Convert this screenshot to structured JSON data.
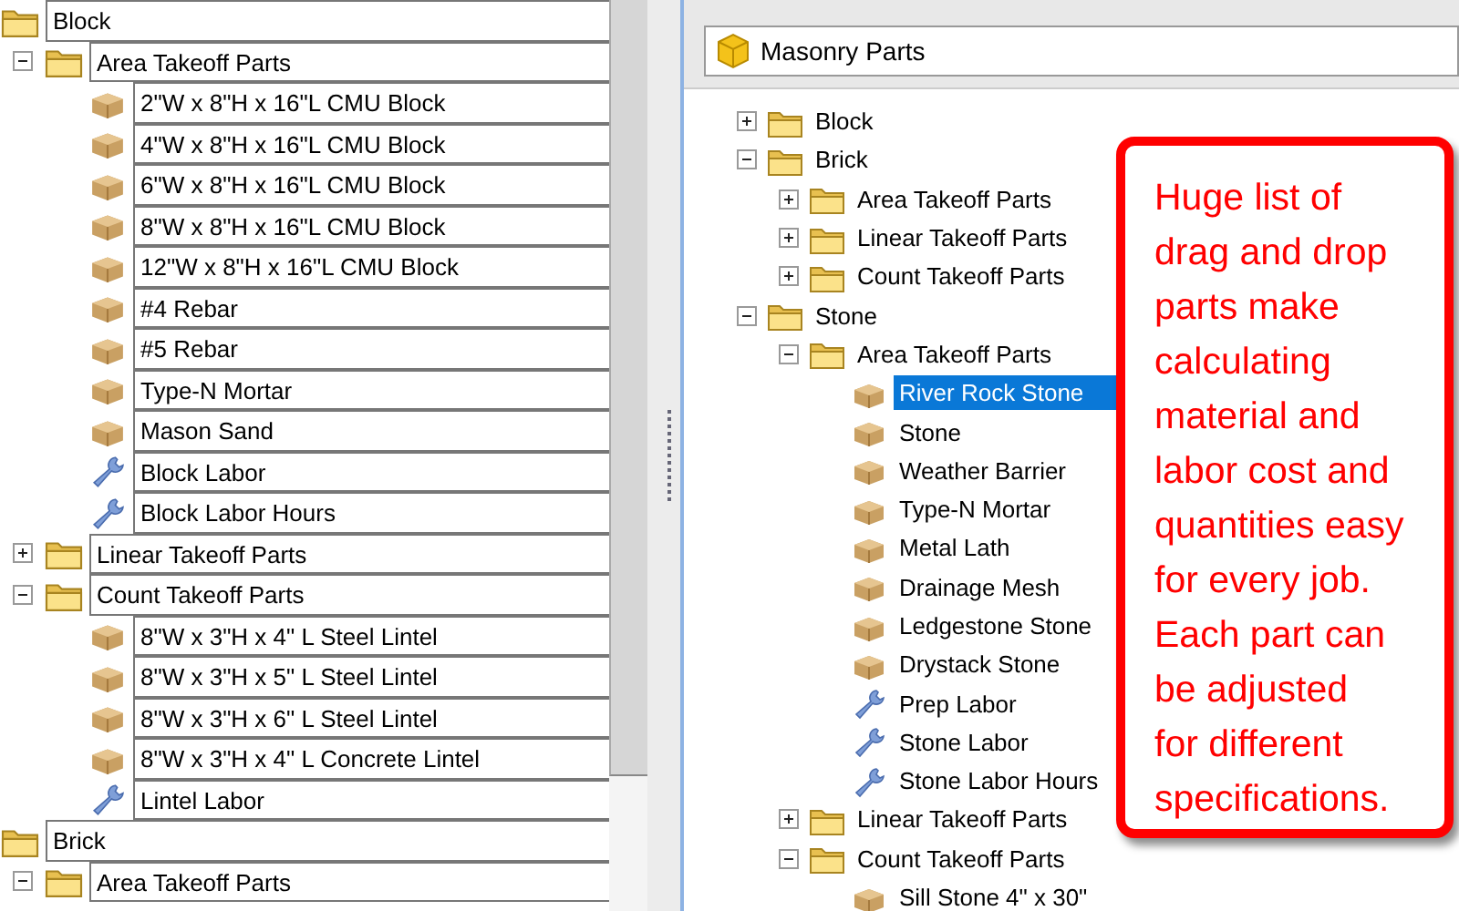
{
  "left_tree": {
    "items": [
      {
        "label": "Block",
        "kind": "folder",
        "children": [
          {
            "label": "Area Takeoff Parts",
            "kind": "folder",
            "expanded": true,
            "children": [
              {
                "label": "2\"W x 8\"H x 16\"L CMU Block",
                "kind": "part"
              },
              {
                "label": "4\"W x 8\"H x 16\"L CMU Block",
                "kind": "part"
              },
              {
                "label": "6\"W x 8\"H x 16\"L CMU Block",
                "kind": "part"
              },
              {
                "label": "8\"W x 8\"H x 16\"L CMU Block",
                "kind": "part"
              },
              {
                "label": "12\"W x 8\"H x 16\"L CMU Block",
                "kind": "part"
              },
              {
                "label": "#4 Rebar",
                "kind": "part"
              },
              {
                "label": "#5 Rebar",
                "kind": "part"
              },
              {
                "label": "Type-N Mortar",
                "kind": "part"
              },
              {
                "label": "Mason Sand",
                "kind": "part"
              },
              {
                "label": "Block Labor",
                "kind": "labor"
              },
              {
                "label": "Block Labor Hours",
                "kind": "labor"
              }
            ]
          },
          {
            "label": "Linear Takeoff Parts",
            "kind": "folder",
            "expanded": false
          },
          {
            "label": "Count Takeoff Parts",
            "kind": "folder",
            "expanded": true,
            "children": [
              {
                "label": "8\"W x 3\"H x 4\" L Steel Lintel",
                "kind": "part"
              },
              {
                "label": "8\"W x 3\"H x 5\" L Steel Lintel",
                "kind": "part"
              },
              {
                "label": "8\"W x 3\"H x 6\" L Steel Lintel",
                "kind": "part"
              },
              {
                "label": "8\"W x 3\"H x 4\" L Concrete Lintel",
                "kind": "part"
              },
              {
                "label": "Lintel Labor",
                "kind": "labor"
              }
            ]
          }
        ]
      },
      {
        "label": "Brick",
        "kind": "folder",
        "children": [
          {
            "label": "Area Takeoff Parts",
            "kind": "folder",
            "expanded": true
          }
        ]
      }
    ]
  },
  "right_panel": {
    "root": "Masonry Parts",
    "items": [
      {
        "label": "Block",
        "kind": "folder",
        "expanded": false,
        "selected": false
      },
      {
        "label": "Brick",
        "kind": "folder",
        "expanded": true,
        "selected": false,
        "children": [
          {
            "label": "Area Takeoff Parts",
            "kind": "folder",
            "expanded": false,
            "selected": false
          },
          {
            "label": "Linear Takeoff Parts",
            "kind": "folder",
            "expanded": false,
            "selected": false
          },
          {
            "label": "Count Takeoff Parts",
            "kind": "folder",
            "expanded": false,
            "selected": false
          }
        ]
      },
      {
        "label": "Stone",
        "kind": "folder",
        "expanded": true,
        "selected": false,
        "children": [
          {
            "label": "Area Takeoff Parts",
            "kind": "folder",
            "expanded": true,
            "selected": false,
            "children": [
              {
                "label": "River Rock Stone",
                "kind": "part",
                "selected": true
              },
              {
                "label": "Stone",
                "kind": "part",
                "selected": false
              },
              {
                "label": "Weather Barrier",
                "kind": "part",
                "selected": false
              },
              {
                "label": "Type-N Mortar",
                "kind": "part",
                "selected": false
              },
              {
                "label": "Metal Lath",
                "kind": "part",
                "selected": false
              },
              {
                "label": "Drainage Mesh",
                "kind": "part",
                "selected": false
              },
              {
                "label": "Ledgestone Stone",
                "kind": "part",
                "selected": false
              },
              {
                "label": "Drystack Stone",
                "kind": "part",
                "selected": false
              },
              {
                "label": "Prep Labor",
                "kind": "labor",
                "selected": false
              },
              {
                "label": "Stone Labor",
                "kind": "labor",
                "selected": false
              },
              {
                "label": "Stone Labor Hours",
                "kind": "labor",
                "selected": false
              }
            ]
          },
          {
            "label": "Linear Takeoff Parts",
            "kind": "folder",
            "expanded": false,
            "selected": false
          },
          {
            "label": "Count Takeoff Parts",
            "kind": "folder",
            "expanded": true,
            "selected": false,
            "children": [
              {
                "label": "Sill Stone 4\" x 30\"",
                "kind": "part",
                "selected": false
              }
            ]
          }
        ]
      }
    ]
  },
  "callout": {
    "lines": [
      "Huge list of",
      "drag and drop",
      "parts make",
      "calculating",
      "material and",
      "labor cost and",
      "quantities easy",
      "for every job.",
      "Each part can",
      "be adjusted",
      "for different",
      "specifications."
    ]
  }
}
